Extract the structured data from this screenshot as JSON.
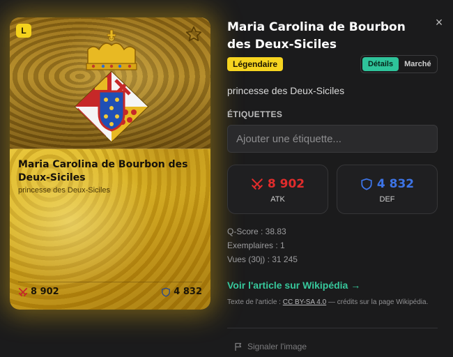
{
  "card": {
    "rarity_letter": "L",
    "title": "Maria Carolina de Bourbon des Deux-Siciles",
    "subtitle": "princesse des Deux-Siciles",
    "atk": "8 902",
    "def": "4 832",
    "glow_color": "#e6b414"
  },
  "panel": {
    "title": "Maria Carolina de Bourbon des Deux-Siciles",
    "close_icon": "×",
    "rarity_label": "Légendaire",
    "tabs": [
      {
        "label": "Détails",
        "active": true
      },
      {
        "label": "Marché",
        "active": false
      }
    ],
    "subtitle": "princesse des Deux-Siciles",
    "tags_label": "ÉTIQUETTES",
    "tag_placeholder": "Ajouter une étiquette...",
    "atk": {
      "value": "8 902",
      "label": "ATK",
      "color": "#e12c2c"
    },
    "def": {
      "value": "4 832",
      "label": "DEF",
      "color": "#3d74e6"
    },
    "meta": [
      "Q-Score : 38.83",
      "Exemplaires : 1",
      "Vues (30j) : 31 245"
    ],
    "wiki_link": "Voir l'article sur Wikipédia →",
    "license_prefix": "Texte de l'article : ",
    "license_link": "CC BY-SA 4.0",
    "license_suffix": " — crédits sur la page Wikipédia.",
    "report_label": "Signaler l'image",
    "accent": "#2ec39a",
    "legendary_color": "#f6d420"
  }
}
